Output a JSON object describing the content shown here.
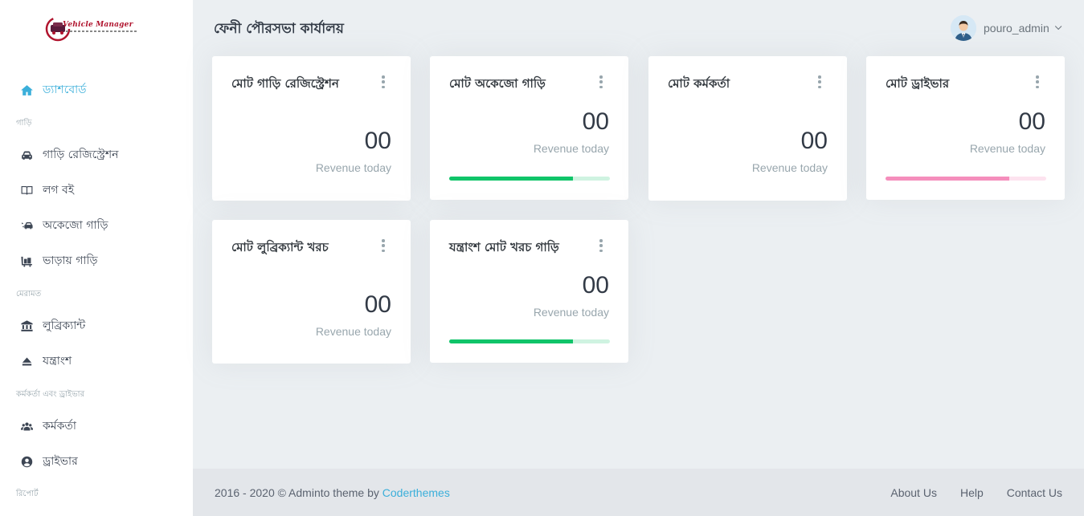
{
  "logo": {
    "text": "Vehicle Manager"
  },
  "header": {
    "page_title": "ফেনী পৌরসভা কার্যালয়",
    "user_name": "pouro_admin"
  },
  "sidebar": {
    "items": [
      {
        "label": "ড্যাশবোর্ড",
        "icon": "home-icon",
        "active": true
      },
      {
        "section": "গাড়ি"
      },
      {
        "label": "গাড়ি রেজিস্ট্রেশন",
        "icon": "car-icon"
      },
      {
        "label": "লগ বই",
        "icon": "book-icon"
      },
      {
        "label": "অকেজো গাড়ি",
        "icon": "car-crash-icon"
      },
      {
        "label": "ভাড়ায় গাড়ি",
        "icon": "luggage-cart-icon"
      },
      {
        "section": "মেরামত"
      },
      {
        "label": "লুব্রিক্যান্ট",
        "icon": "bank-icon"
      },
      {
        "label": "যন্ত্রাংশ",
        "icon": "eject-icon"
      },
      {
        "section": "কর্মকর্তা এবং ড্রাইভার"
      },
      {
        "label": "কর্মকর্তা",
        "icon": "users-icon"
      },
      {
        "label": "ড্রাইভার",
        "icon": "user-circle-icon"
      },
      {
        "section": "রিপোর্ট"
      }
    ]
  },
  "cards": [
    {
      "title": "মোট গাড়ি রেজিস্ট্রেশন",
      "value": "00",
      "sub": "Revenue today",
      "progress": null
    },
    {
      "title": "মোট অকেজো গাড়ি",
      "value": "00",
      "sub": "Revenue today",
      "progress": 0.77,
      "color": "#10c469",
      "track": "#cff3e1"
    },
    {
      "title": "মোট কর্মকর্তা",
      "value": "00",
      "sub": "Revenue today",
      "progress": null
    },
    {
      "title": "মোট ড্রাইভার",
      "value": "00",
      "sub": "Revenue today",
      "progress": 0.77,
      "color": "#f58ebc",
      "track": "#fde3ef"
    },
    {
      "title": "মোট লুব্রিক্যান্ট খরচ",
      "value": "00",
      "sub": "Revenue today",
      "progress": null
    },
    {
      "title": "যন্ত্রাংশ মোট খরচ গাড়ি",
      "value": "00",
      "sub": "Revenue today",
      "progress": 0.77,
      "color": "#10c469",
      "track": "#cff3e1"
    }
  ],
  "footer": {
    "copyright": "2016 - 2020 © Adminto theme by",
    "brand_link": "Coderthemes",
    "links": [
      "About Us",
      "Help",
      "Contact Us"
    ]
  },
  "colors": {
    "accent": "#3bafda",
    "success": "#10c469",
    "pink": "#f58ebc"
  }
}
